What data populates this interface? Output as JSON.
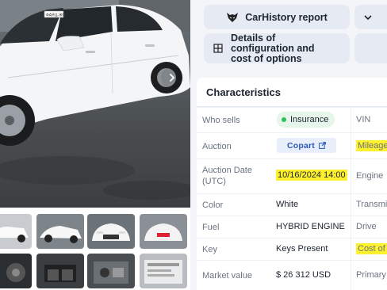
{
  "gallery": {
    "plate_text": "ФАЯЦ-ЖОЗ",
    "thumbnails": [
      "thumb-1",
      "thumb-2",
      "thumb-3",
      "thumb-4",
      "thumb-5",
      "thumb-6",
      "thumb-7",
      "thumb-8"
    ]
  },
  "actions": {
    "carhistory_label": "CarHistory report",
    "config_label": "Details of configuration and cost of options"
  },
  "characteristics": {
    "title": "Characteristics",
    "rows": [
      {
        "label": "Who sells",
        "value": "Insurance",
        "label2": "VIN"
      },
      {
        "label": "Auction",
        "value": "Copart",
        "label2": "Mileage"
      },
      {
        "label": "Auction Date (UTC)",
        "value": "10/16/2024 14:00",
        "label2": "Engine"
      },
      {
        "label": "Color",
        "value": "White",
        "label2": "Transmi"
      },
      {
        "label": "Fuel",
        "value": "HYBRID ENGINE",
        "label2": "Drive"
      },
      {
        "label": "Key",
        "value": "Keys Present",
        "label2": "Cost of"
      },
      {
        "label": "Market value",
        "value": "$ 26 312 USD",
        "label2": "Primary"
      }
    ]
  },
  "colors": {
    "highlight": "#fdf02c",
    "status_green": "#2fbf5c",
    "link_blue": "#2a58b8",
    "button_bg": "#e6ebf3"
  }
}
